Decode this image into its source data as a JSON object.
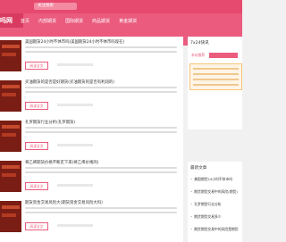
{
  "search_placeholder": "关注搜索",
  "logo": "吗网",
  "nav": [
    "首页",
    "内部期货",
    "国际期货",
    "商品期货",
    "黄金期货"
  ],
  "items": [
    {
      "title": "美国期货24小时不休市吗(美国期货24小时不休市吗现在)",
      "more": "阅读全文"
    },
    {
      "title": "买油期货的是否是好期货(买油期货的是否有利润的)",
      "more": "阅读全文"
    },
    {
      "title": "孔罗期货行业分析(孔罗期货)",
      "more": "阅读全文"
    },
    {
      "title": "将乙烯期货价格不断走下来(将乙烯价格的)",
      "more": "阅读全文"
    },
    {
      "title": "期货资金交易风险大(期货资金交易风险大吗)",
      "more": "阅读全文"
    }
  ],
  "sidebar": {
    "box1_title": "7x24快讯",
    "pin_label": "本站推荐",
    "box2_title": "最新文章",
    "recent": [
      "美国期货24小时不休市吗",
      "期货期货交易中的风险(期货)",
      "孔罗期货行业分析",
      "期货期货交易多少",
      "期货期货交易中的风险是期货"
    ]
  }
}
